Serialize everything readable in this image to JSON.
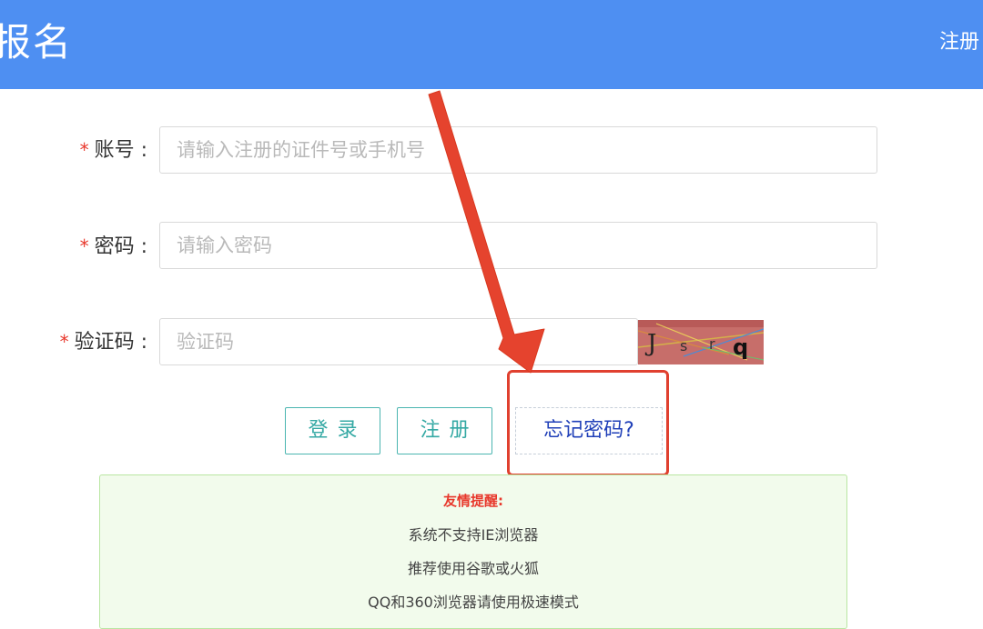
{
  "header": {
    "title": "报名",
    "register_link": "注册"
  },
  "form": {
    "account": {
      "required_mark": "*",
      "label": "账号 :",
      "placeholder": "请输入注册的证件号或手机号"
    },
    "password": {
      "required_mark": "*",
      "label": "密码 :",
      "placeholder": "请输入密码"
    },
    "captcha": {
      "required_mark": "*",
      "label": "验证码 :",
      "placeholder": "验证码",
      "image_text": "J s r q"
    }
  },
  "buttons": {
    "login": "登录",
    "register": "注册",
    "forgot_password": "忘记密码?"
  },
  "notice": {
    "title": "友情提醒:",
    "lines": [
      "系统不支持IE浏览器",
      "推荐使用谷歌或火狐",
      "QQ和360浏览器请使用极速模式"
    ]
  },
  "colors": {
    "header_bg": "#4e8ff2",
    "required": "#e8382c",
    "button_accent": "#35a9a4",
    "forgot_link": "#1f3fb8",
    "annotation": "#e0402f",
    "notice_bg": "#f2fbec"
  }
}
